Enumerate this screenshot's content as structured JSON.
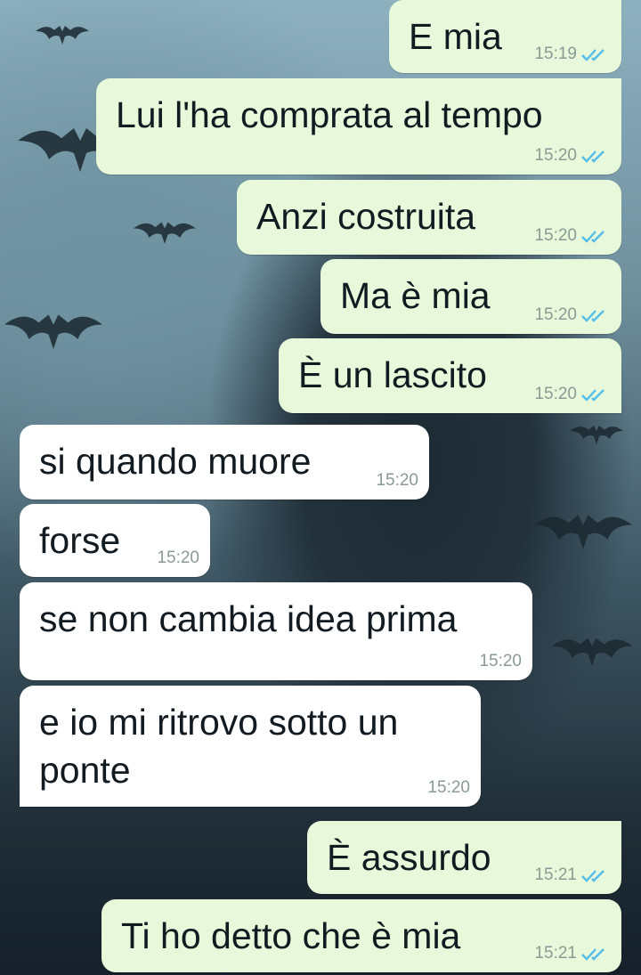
{
  "chat": {
    "background_description": "",
    "colors": {
      "outgoing_bubble": "#e7f9da",
      "incoming_bubble": "#ffffff",
      "read_ticks": "#53bdeb"
    },
    "messages": [
      {
        "direction": "outgoing",
        "text": "E mia",
        "time": "15:19",
        "status_icon": "double-check-icon"
      },
      {
        "direction": "outgoing",
        "text": "Lui l'ha comprata al tempo",
        "time": "15:20",
        "status_icon": "double-check-icon"
      },
      {
        "direction": "outgoing",
        "text": "Anzi costruita",
        "time": "15:20",
        "status_icon": "double-check-icon"
      },
      {
        "direction": "outgoing",
        "text": "Ma è mia",
        "time": "15:20",
        "status_icon": "double-check-icon"
      },
      {
        "direction": "outgoing",
        "text": "È un lascito",
        "time": "15:20",
        "status_icon": "double-check-icon"
      },
      {
        "direction": "incoming",
        "text": "si quando muore",
        "time": "15:20"
      },
      {
        "direction": "incoming",
        "text": "forse",
        "time": "15:20"
      },
      {
        "direction": "incoming",
        "text": "se non cambia idea prima",
        "time": "15:20"
      },
      {
        "direction": "incoming",
        "text": "e io mi ritrovo sotto un ponte",
        "time": "15:20"
      },
      {
        "direction": "outgoing",
        "text": "È assurdo",
        "time": "15:21",
        "status_icon": "double-check-icon"
      },
      {
        "direction": "outgoing",
        "text": "Ti ho detto che è mia",
        "time": "15:21",
        "status_icon": "double-check-icon"
      }
    ]
  }
}
